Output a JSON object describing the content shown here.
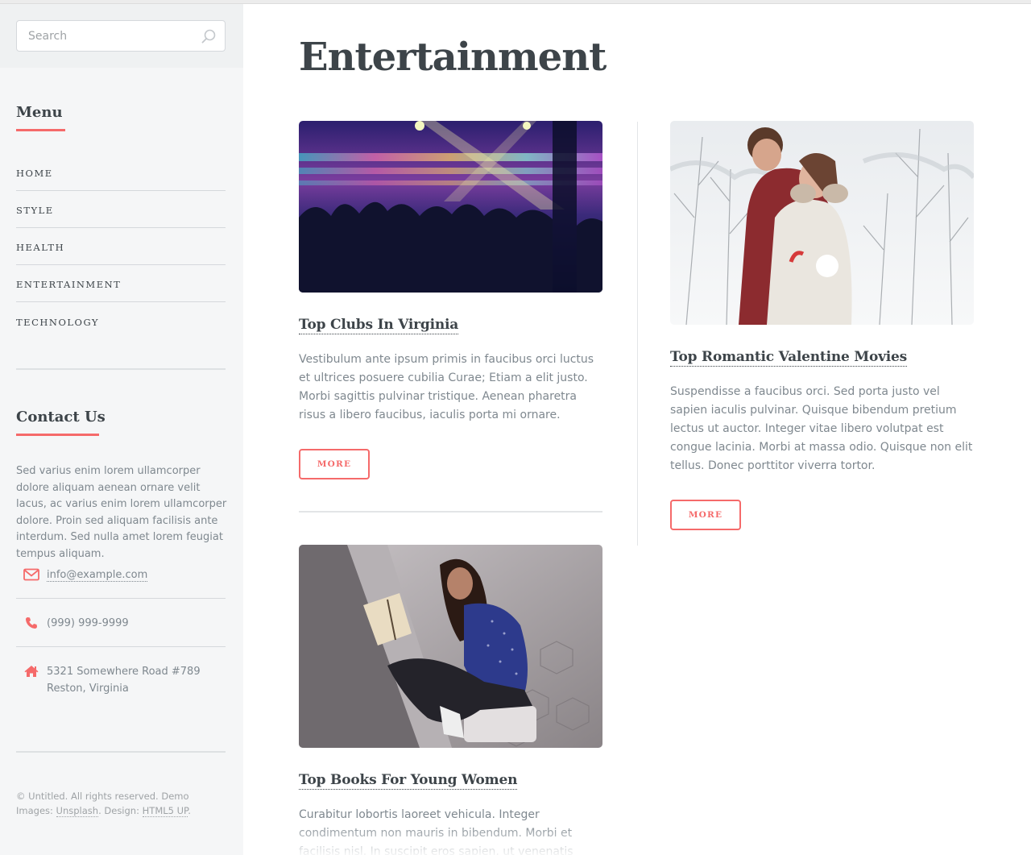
{
  "search": {
    "placeholder": "Search"
  },
  "menu": {
    "heading": "Menu",
    "items": [
      {
        "label": "HOME"
      },
      {
        "label": "STYLE"
      },
      {
        "label": "HEALTH"
      },
      {
        "label": "ENTERTAINMENT"
      },
      {
        "label": "TECHNOLOGY"
      }
    ]
  },
  "contact": {
    "heading": "Contact Us",
    "text": "Sed varius enim lorem ullamcorper dolore aliquam aenean ornare velit lacus, ac varius enim lorem ullamcorper dolore. Proin sed aliquam facilisis ante interdum. Sed nulla amet lorem feugiat tempus aliquam.",
    "email": "info@example.com",
    "phone": "(999) 999-9999",
    "address_line1": "5321 Somewhere Road #789",
    "address_line2": "Reston, Virginia"
  },
  "footer": {
    "copyright": "© Untitled. All rights reserved. Demo Images:",
    "unsplash": "Unsplash",
    "design_label": ". Design:",
    "html5up": "HTML5 UP",
    "end": "."
  },
  "main": {
    "title": "Entertainment",
    "posts": [
      {
        "title": "Top Clubs In Virginia",
        "text": "Vestibulum ante ipsum primis in faucibus orci luctus et ultrices posuere cubilia Curae; Etiam a elit justo. Morbi sagittis pulvinar tristique. Aenean pharetra risus a libero faucibus, iaculis porta mi ornare.",
        "button": "MORE"
      },
      {
        "title": "Top Romantic Valentine Movies",
        "text": "Suspendisse a faucibus orci. Sed porta justo vel sapien iaculis pulvinar. Quisque bibendum pretium lectus ut auctor. Integer vitae libero volutpat est congue lacinia. Morbi at massa odio. Quisque non elit tellus. Donec porttitor viverra tortor.",
        "button": "MORE"
      },
      {
        "title": "Top Books For Young Women",
        "text": "Curabitur lobortis laoreet vehicula. Integer condimentum non mauris in bibendum. Morbi et facilisis nisl. In suscipit eros sapien, ut venenatis quam interdum gravida."
      }
    ]
  },
  "colors": {
    "accent": "#f56a6a",
    "heading": "#3d4449",
    "text": "#7f888f"
  },
  "icons": [
    "search-icon",
    "envelope-icon",
    "phone-icon",
    "home-icon"
  ]
}
